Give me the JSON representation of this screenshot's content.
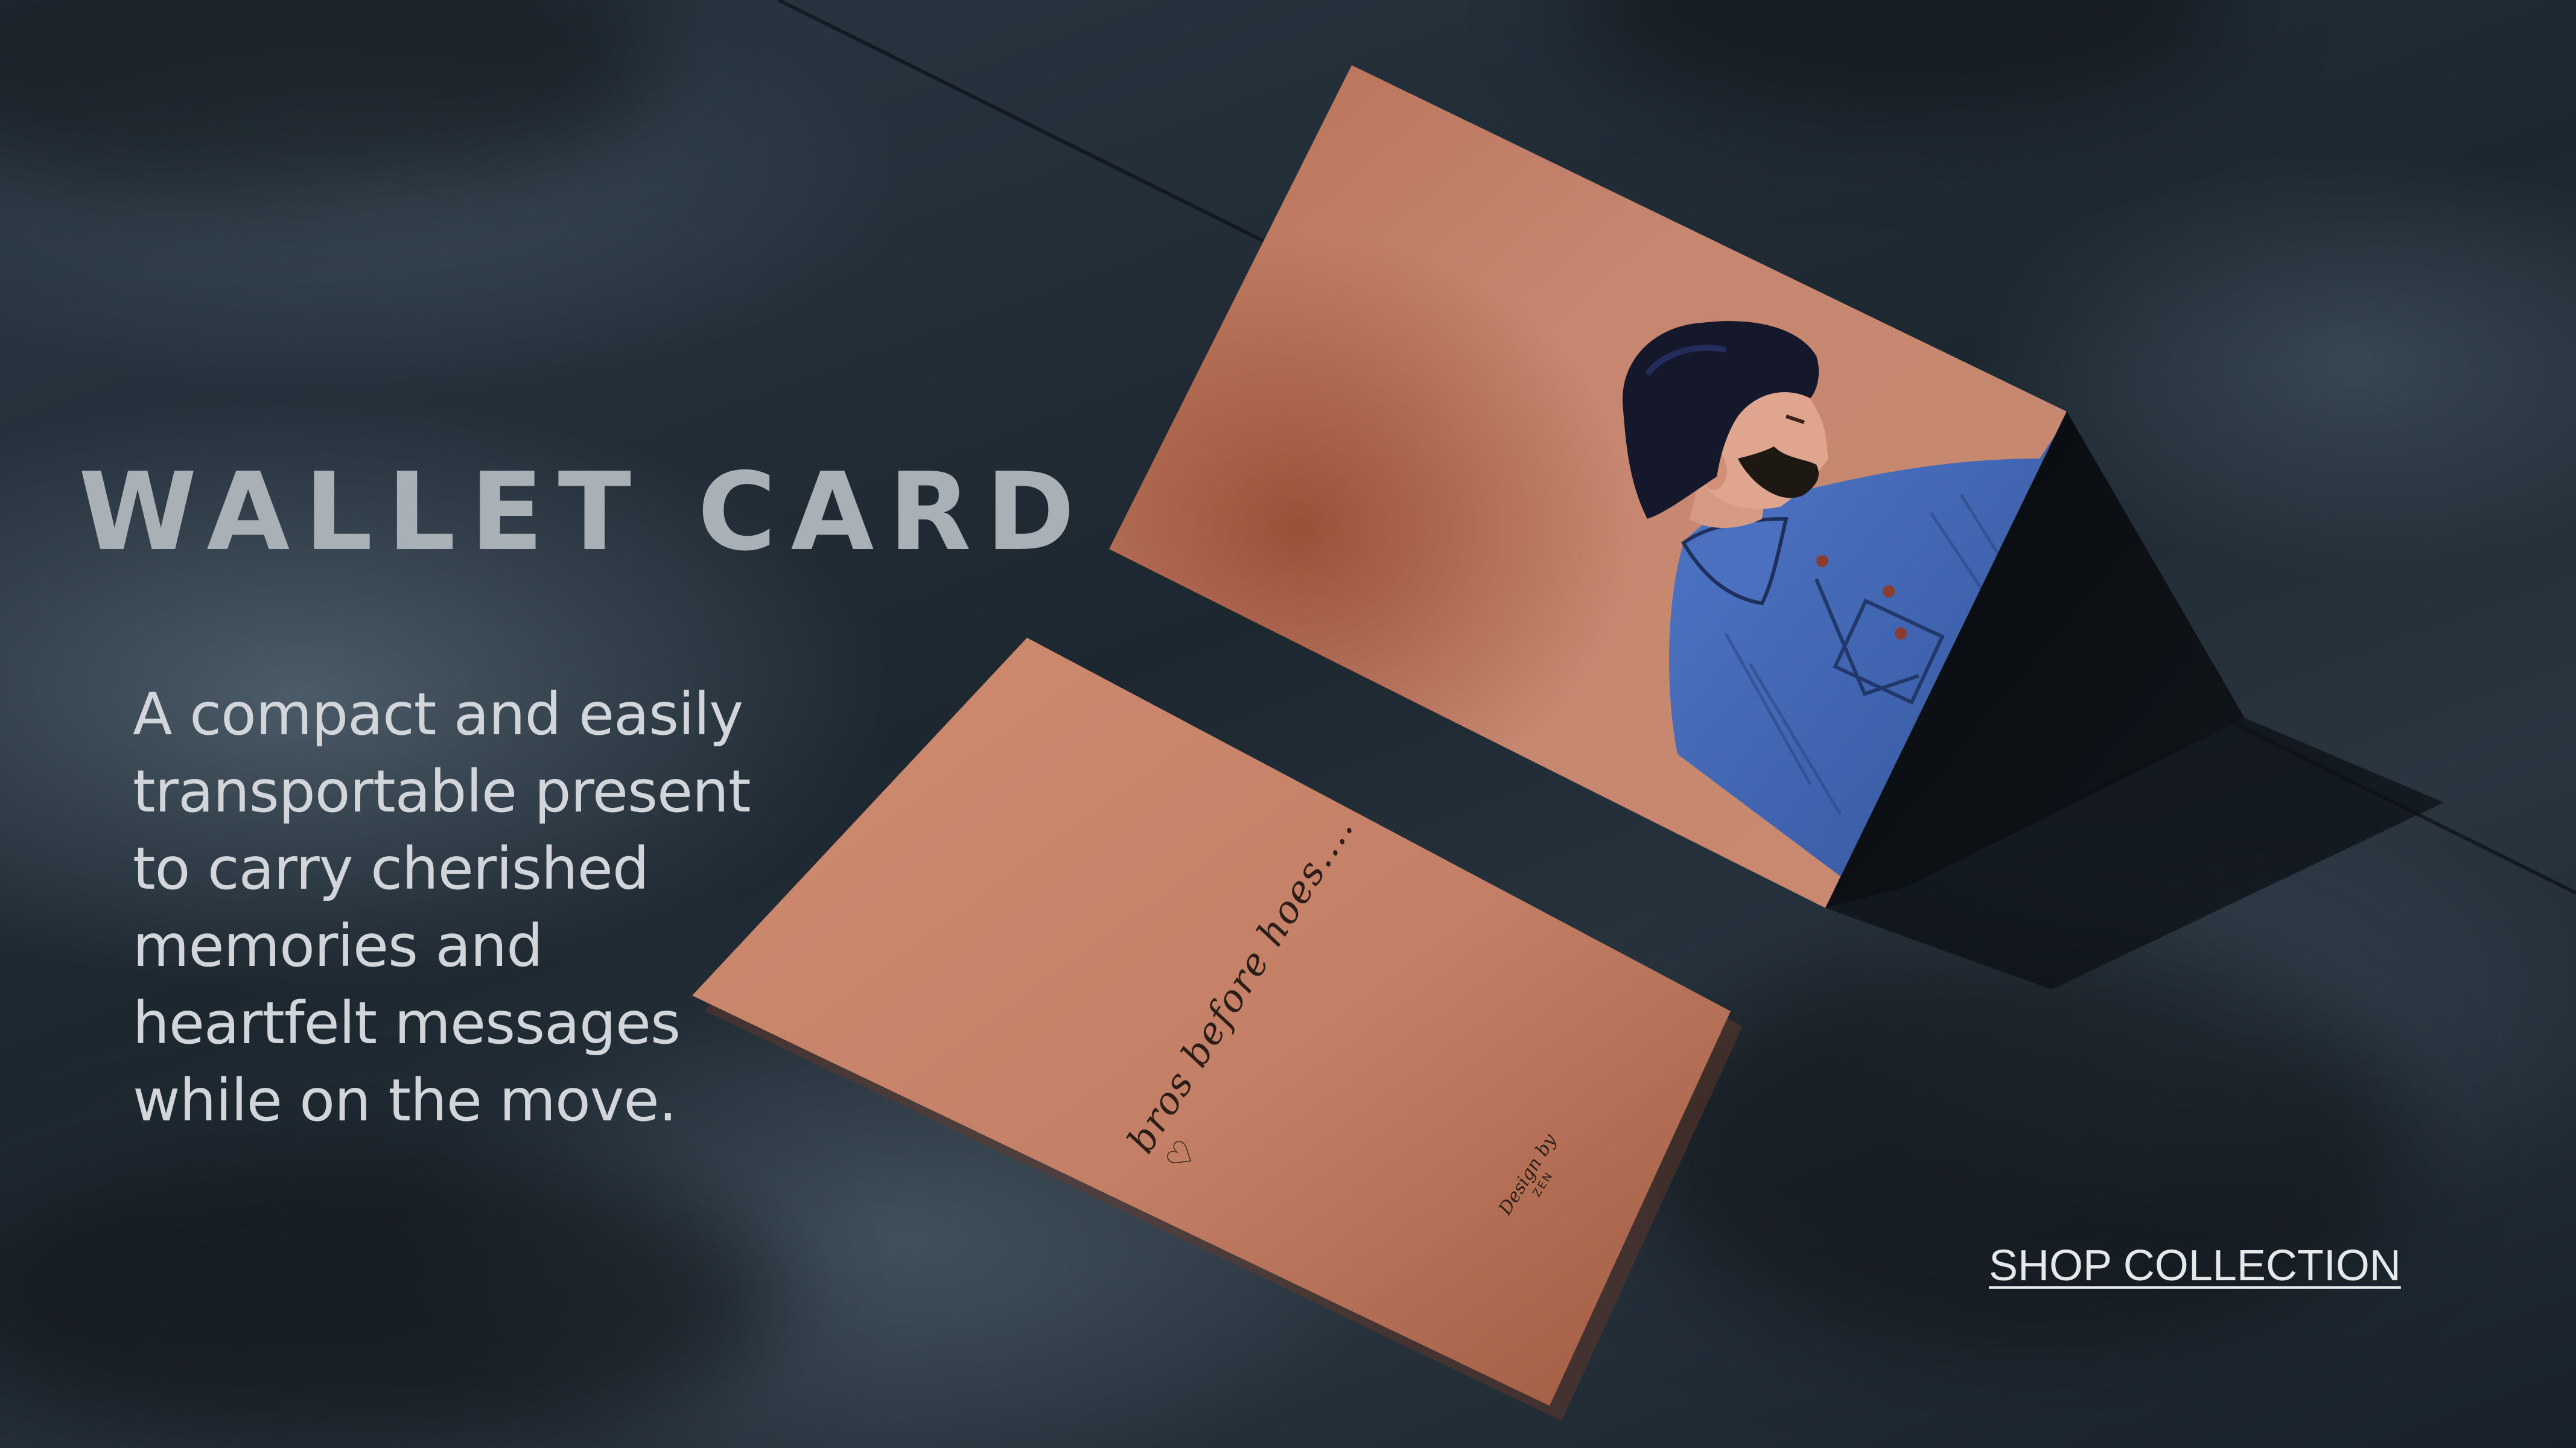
{
  "hero": {
    "title": "WALLET CARD",
    "description_lines": [
      "A compact and easily",
      "transportable present",
      "to carry cherished",
      "memories and",
      "heartfelt messages",
      "while on the move."
    ],
    "cta_label": "SHOP COLLECTION"
  },
  "card_back": {
    "message": "bros before hoes....",
    "heart_icon": "heart-icon",
    "credit_line1": "Design by",
    "credit_line2": "ZEN"
  },
  "card_front": {
    "illustration": "bearded-man-portrait"
  },
  "colors": {
    "background": "#1f2a33",
    "card": "#c07e62",
    "card_shadow": "#8a4a33",
    "shirt": "#3f63b0",
    "hair": "#15192b",
    "skin": "#d89a82",
    "title": "#a9b0b6",
    "body_text": "#d2d6da",
    "cta": "#e6e8ea"
  }
}
